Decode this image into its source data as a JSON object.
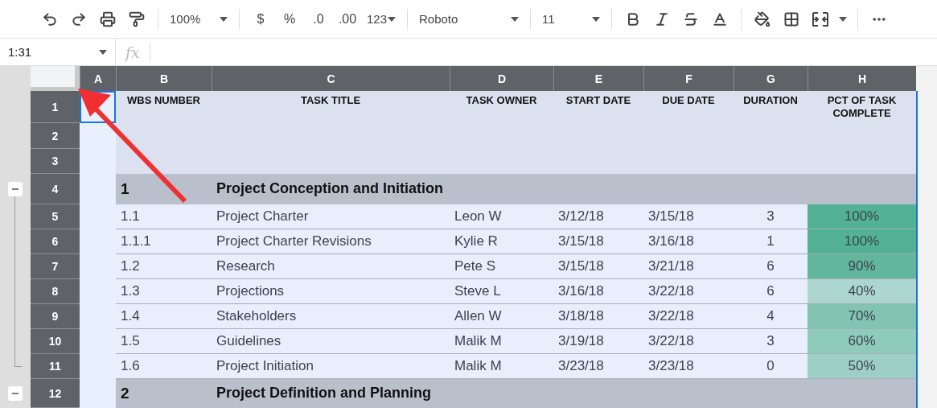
{
  "toolbar": {
    "zoom": "100%",
    "currency": "$",
    "percent": "%",
    "decrease_decimal": ".0",
    "increase_decimal": ".00",
    "more_formats": "123",
    "font": "Roboto",
    "font_size": "11"
  },
  "formula_bar": {
    "name_box": "1:31",
    "fx": "fx"
  },
  "columns": [
    "A",
    "B",
    "C",
    "D",
    "E",
    "F",
    "G",
    "H"
  ],
  "header_row": {
    "number": "1",
    "cursor_in_column_a": true,
    "cells": [
      "WBS NUMBER",
      "TASK TITLE",
      "TASK OWNER",
      "START DATE",
      "DUE DATE",
      "DURATION",
      "PCT OF TASK COMPLETE"
    ]
  },
  "blank_rows": [
    "2",
    "3"
  ],
  "sections": [
    {
      "row": "4",
      "wbs": "1",
      "title": "Project Conception and Initiation",
      "expanded": true,
      "children": [
        {
          "row": "5",
          "wbs": "1.1",
          "title": "Project Charter",
          "owner": "Leon W",
          "start": "3/12/18",
          "due": "3/15/18",
          "duration": "3",
          "pct": "100%",
          "color": "#52b293"
        },
        {
          "row": "6",
          "wbs": "1.1.1",
          "title": "Project Charter Revisions",
          "owner": "Kylie R",
          "start": "3/15/18",
          "due": "3/16/18",
          "duration": "1",
          "pct": "100%",
          "color": "#52b293"
        },
        {
          "row": "7",
          "wbs": "1.2",
          "title": "Research",
          "owner": "Pete S",
          "start": "3/15/18",
          "due": "3/21/18",
          "duration": "6",
          "pct": "90%",
          "color": "#62b69b"
        },
        {
          "row": "8",
          "wbs": "1.3",
          "title": "Projections",
          "owner": "Steve L",
          "start": "3/16/18",
          "due": "3/22/18",
          "duration": "6",
          "pct": "40%",
          "color": "#aed6d1"
        },
        {
          "row": "9",
          "wbs": "1.4",
          "title": "Stakeholders",
          "owner": "Allen W",
          "start": "3/18/18",
          "due": "3/22/18",
          "duration": "4",
          "pct": "70%",
          "color": "#80c4b1"
        },
        {
          "row": "10",
          "wbs": "1.5",
          "title": "Guidelines",
          "owner": "Malik M",
          "start": "3/19/18",
          "due": "3/22/18",
          "duration": "3",
          "pct": "60%",
          "color": "#8ecbba"
        },
        {
          "row": "11",
          "wbs": "1.6",
          "title": "Project Initiation",
          "owner": "Malik M",
          "start": "3/23/18",
          "due": "3/23/18",
          "duration": "0",
          "pct": "50%",
          "color": "#9ecfc6"
        }
      ]
    },
    {
      "row": "12",
      "wbs": "2",
      "title": "Project Definition and Planning",
      "expanded": true
    }
  ]
}
